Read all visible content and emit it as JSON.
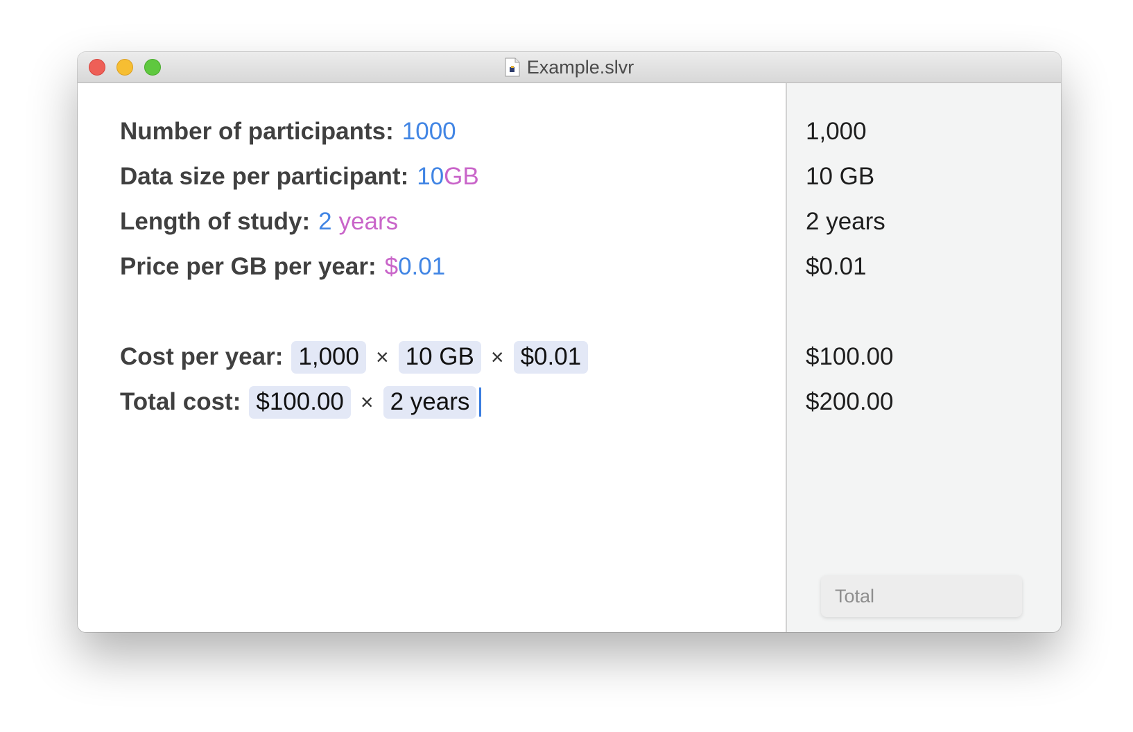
{
  "window": {
    "title": "Example.slvr",
    "title_icon": "document-icon"
  },
  "editor": {
    "lines": [
      {
        "label": "Number of participants:",
        "number": "1000",
        "unit": ""
      },
      {
        "label": "Data size per participant:",
        "number": "10",
        "unit": "GB"
      },
      {
        "label": "Length of study:",
        "number": "2",
        "unit": "years"
      },
      {
        "label": "Price per GB per year:",
        "unit": "$",
        "number": "0.01"
      }
    ],
    "cost_per_year": {
      "label": "Cost per year:",
      "tokens": [
        "1,000",
        "10 GB",
        "$0.01"
      ],
      "operator": "×"
    },
    "total_cost": {
      "label": "Total cost:",
      "tokens": [
        "$100.00",
        "2 years"
      ],
      "operator": "×"
    }
  },
  "results": {
    "values": [
      "1,000",
      "10 GB",
      "2 years",
      "$0.01",
      "$100.00",
      "$200.00"
    ],
    "total_input": {
      "placeholder": "Total",
      "value": ""
    }
  },
  "colors": {
    "number": "#4185e4",
    "unit": "#c965c9",
    "token_bg": "#e3e8f6",
    "caret": "#3b7ee0"
  }
}
